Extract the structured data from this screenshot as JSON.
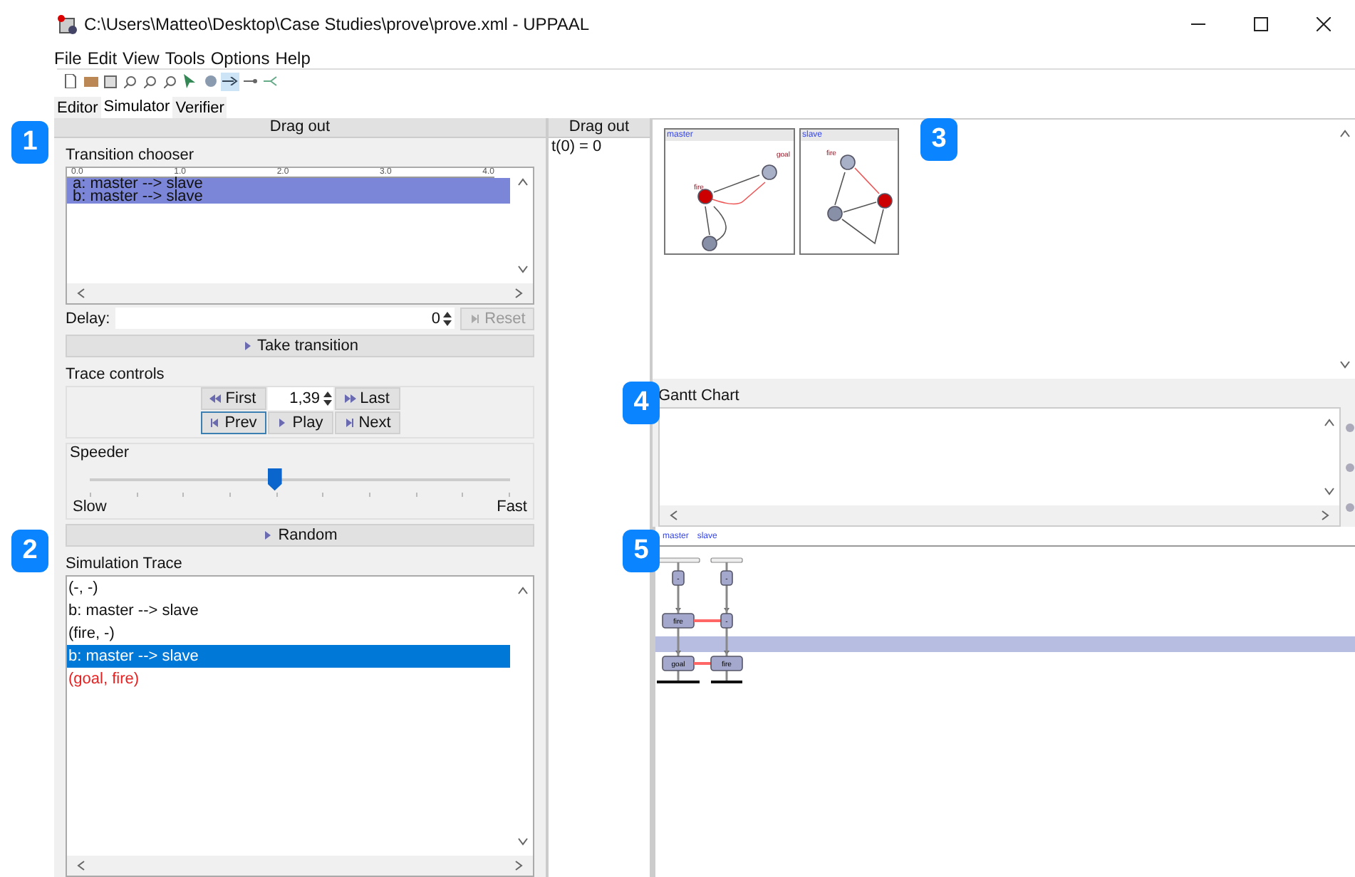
{
  "window": {
    "title": "C:\\Users\\Matteo\\Desktop\\Case Studies\\prove\\prove.xml - UPPAAL"
  },
  "menu": [
    "File",
    "Edit",
    "View",
    "Tools",
    "Options",
    "Help"
  ],
  "toolbar": [
    {
      "kind": "new",
      "selected": false
    },
    {
      "kind": "open",
      "selected": false
    },
    {
      "kind": "save",
      "selected": false
    },
    {
      "kind": "zoom",
      "selected": false
    },
    {
      "kind": "zoom",
      "selected": false
    },
    {
      "kind": "zoom",
      "selected": false
    },
    {
      "kind": "pointer",
      "selected": false
    },
    {
      "kind": "location",
      "selected": false
    },
    {
      "kind": "edge",
      "selected": true
    },
    {
      "kind": "nail",
      "selected": false
    },
    {
      "kind": "branch",
      "selected": false
    }
  ],
  "tabs": [
    {
      "label": "Editor",
      "selected": false
    },
    {
      "label": "Simulator",
      "selected": true
    },
    {
      "label": "Verifier",
      "selected": false
    }
  ],
  "callouts": [
    "1",
    "2",
    "3",
    "4",
    "5"
  ],
  "left_panel": {
    "header": "Drag out",
    "transition_chooser": {
      "title": "Transition chooser",
      "ruler": [
        "0.0",
        "1.0",
        "2.0",
        "3.0",
        "4.0"
      ],
      "transitions": [
        {
          "label": "a: master --> slave",
          "selected": true
        },
        {
          "label": "b: master --> slave",
          "selected": true
        }
      ]
    },
    "delay": {
      "label": "Delay:",
      "value": "0"
    },
    "reset": {
      "label": "Reset",
      "disabled": true
    },
    "take_transition": "Take transition",
    "trace_controls": {
      "title": "Trace controls",
      "step": "1,39",
      "buttons": [
        {
          "label": "First",
          "kind": "first",
          "focused": false
        },
        {
          "label": "Last",
          "kind": "last",
          "focused": false
        },
        {
          "label": "Prev",
          "kind": "prev",
          "focused": true
        },
        {
          "label": "Play",
          "kind": "play",
          "focused": false
        },
        {
          "label": "Next",
          "kind": "next",
          "focused": false
        }
      ]
    },
    "speeder": {
      "title": "Speeder",
      "level": 0.44,
      "min_label": "Slow",
      "max_label": "Fast"
    },
    "random": "Random",
    "simulation_trace": {
      "title": "Simulation Trace",
      "items": [
        {
          "text": "(-, -)",
          "selected": false,
          "current": false
        },
        {
          "text": "b: master --> slave",
          "selected": false,
          "current": false
        },
        {
          "text": "(fire, -)",
          "selected": false,
          "current": false
        },
        {
          "text": "b: master --> slave",
          "selected": true,
          "current": false
        },
        {
          "text": "(goal, fire)",
          "selected": false,
          "current": true
        }
      ]
    }
  },
  "variables_panel": {
    "header": "Drag out",
    "variables": [
      "t(0) = 0"
    ]
  },
  "processes": [
    {
      "name": "master",
      "locations": [
        "fire",
        "goal"
      ]
    },
    {
      "name": "slave",
      "locations": [
        "fire"
      ]
    }
  ],
  "gantt": {
    "title": "Gantt Chart"
  },
  "sequence_chart": {
    "processes": [
      "master",
      "slave"
    ],
    "steps": [
      {
        "kind": "state",
        "cells": [
          "-",
          "-"
        ],
        "synced": false
      },
      {
        "kind": "transition",
        "selected": false
      },
      {
        "kind": "state",
        "cells": [
          "fire",
          "-"
        ],
        "synced": true
      },
      {
        "kind": "transition",
        "selected": true
      },
      {
        "kind": "state",
        "cells": [
          "goal",
          "fire"
        ],
        "synced": true
      }
    ]
  }
}
